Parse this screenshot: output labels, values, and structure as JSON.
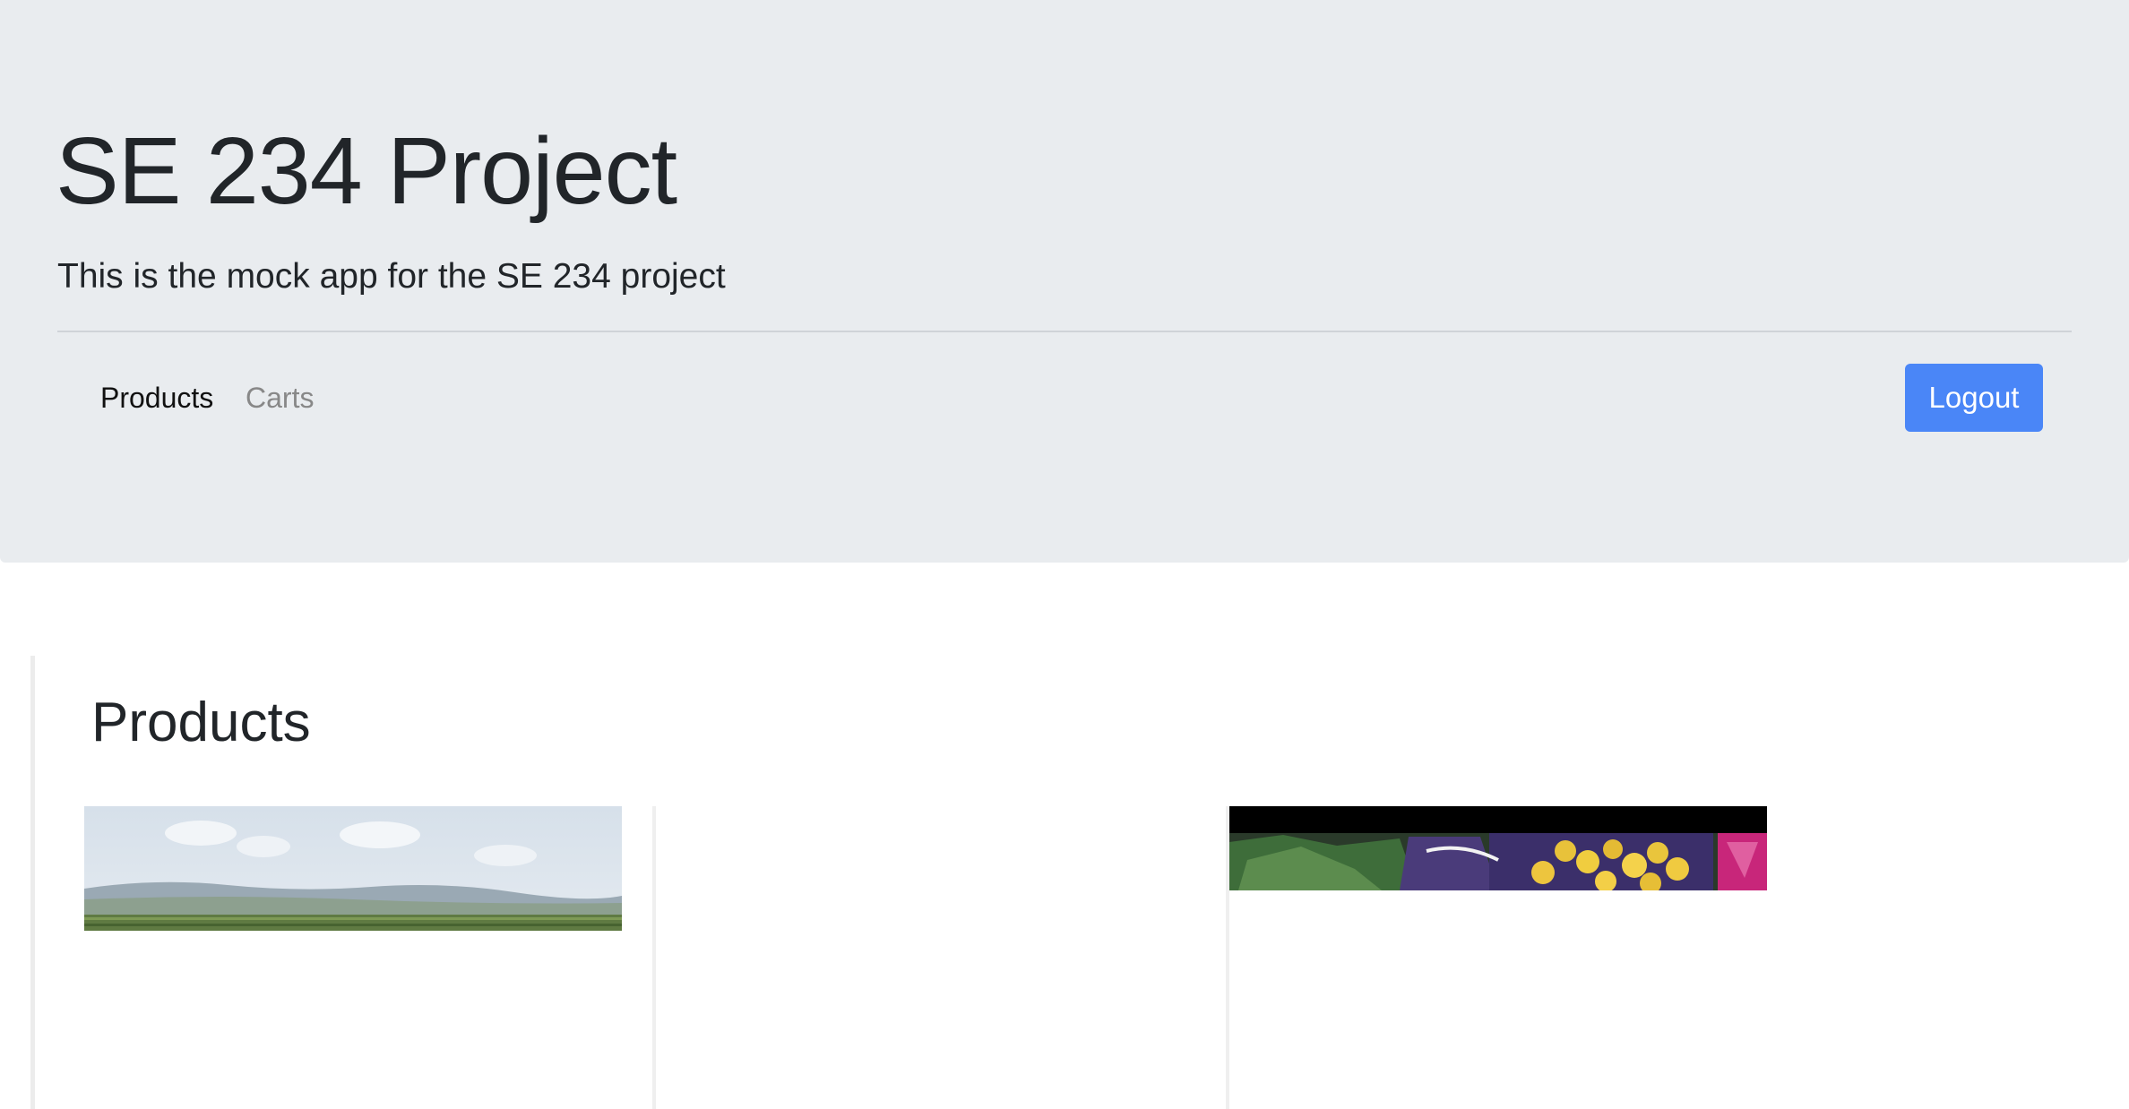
{
  "header": {
    "title": "SE 234 Project",
    "subtitle": "This is the mock app for the SE 234 project"
  },
  "nav": {
    "items": [
      {
        "label": "Products",
        "active": true
      },
      {
        "label": "Carts",
        "active": false
      }
    ],
    "logout_label": "Logout"
  },
  "main": {
    "heading": "Products"
  },
  "colors": {
    "jumbotron_bg": "#e9ecef",
    "primary": "#4a86f7",
    "muted_link": "#888888"
  }
}
